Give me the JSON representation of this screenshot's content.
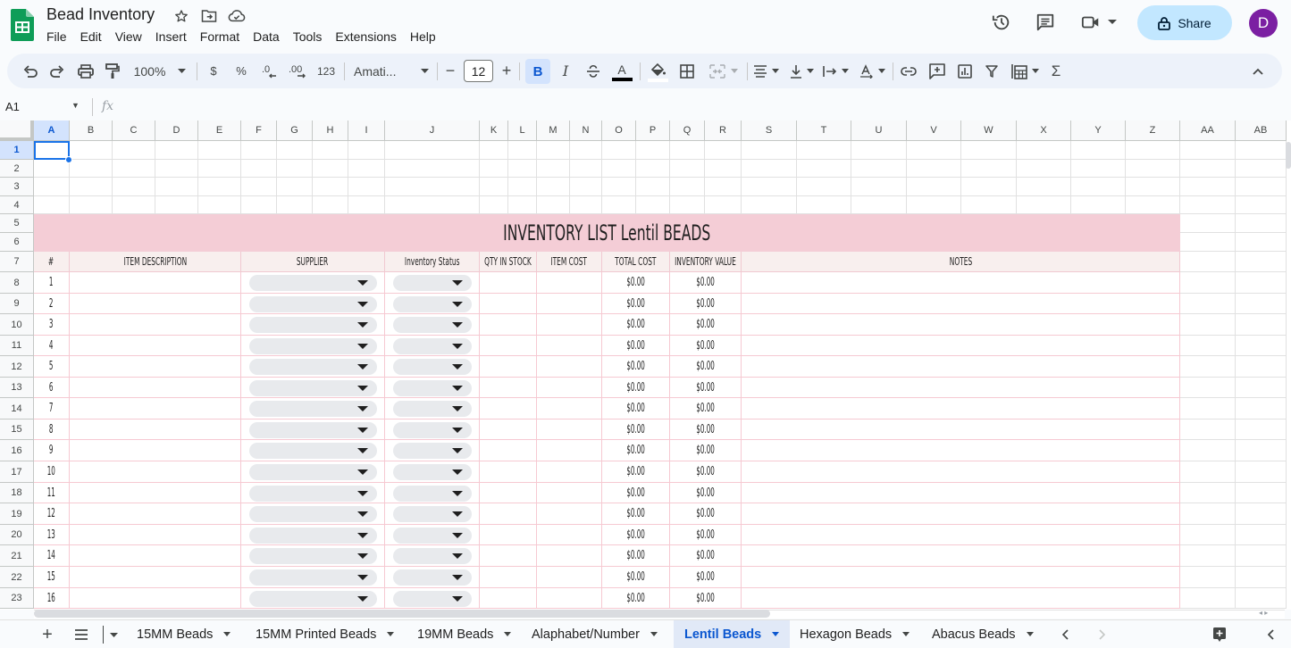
{
  "app": {
    "title": "Bead Inventory",
    "menu": [
      "File",
      "Edit",
      "View",
      "Insert",
      "Format",
      "Data",
      "Tools",
      "Extensions",
      "Help"
    ],
    "share_label": "Share",
    "avatar_initial": "D",
    "colors": {
      "accent": "#0b57d0",
      "share_bg": "#c2e7ff",
      "avatar_bg": "#7b1fa2",
      "banner_bg": "#f4cdd6",
      "header_bg": "#f8efee",
      "border_pink": "#f6c9d2"
    }
  },
  "toolbar": {
    "zoom": "100%",
    "currency": "$",
    "percent": "%",
    "decrease_decimal": ".0",
    "increase_decimal": ".00",
    "number_format": "123",
    "font": "Amati...",
    "font_size": "12",
    "bold_label": "B",
    "italic_label": "I",
    "text_color_label": "A"
  },
  "formula_bar": {
    "name_box": "A1",
    "fx_label": "fx",
    "formula": ""
  },
  "grid": {
    "columns": [
      "A",
      "B",
      "C",
      "D",
      "E",
      "F",
      "G",
      "H",
      "I",
      "J",
      "K",
      "L",
      "M",
      "N",
      "O",
      "P",
      "Q",
      "R",
      "S",
      "T",
      "U",
      "V",
      "W",
      "X",
      "Y",
      "Z",
      "AA",
      "AB"
    ],
    "rows": [
      "1",
      "2",
      "3",
      "4",
      "5",
      "6",
      "7",
      "8",
      "9",
      "10",
      "11",
      "12",
      "13",
      "14",
      "15",
      "16",
      "17",
      "18",
      "19",
      "20",
      "21",
      "22",
      "23"
    ],
    "selected_cell": "A1"
  },
  "sheet": {
    "banner_title": "INVENTORY LIST Lentil BEADS",
    "headers": {
      "number": "#",
      "item_description": "ITEM DESCRIPTION",
      "supplier": "SUPPLIER",
      "inventory_status": "Inventory Status",
      "qty_in_stock": "QTY IN STOCK",
      "item_cost": "ITEM COST",
      "total_cost": "TOTAL COST",
      "inventory_value": "INVENTORY VALUE",
      "notes": "NOTES"
    },
    "rows": [
      {
        "num": "1",
        "total_cost": "$0.00",
        "inventory_value": "$0.00"
      },
      {
        "num": "2",
        "total_cost": "$0.00",
        "inventory_value": "$0.00"
      },
      {
        "num": "3",
        "total_cost": "$0.00",
        "inventory_value": "$0.00"
      },
      {
        "num": "4",
        "total_cost": "$0.00",
        "inventory_value": "$0.00"
      },
      {
        "num": "5",
        "total_cost": "$0.00",
        "inventory_value": "$0.00"
      },
      {
        "num": "6",
        "total_cost": "$0.00",
        "inventory_value": "$0.00"
      },
      {
        "num": "7",
        "total_cost": "$0.00",
        "inventory_value": "$0.00"
      },
      {
        "num": "8",
        "total_cost": "$0.00",
        "inventory_value": "$0.00"
      },
      {
        "num": "9",
        "total_cost": "$0.00",
        "inventory_value": "$0.00"
      },
      {
        "num": "10",
        "total_cost": "$0.00",
        "inventory_value": "$0.00"
      },
      {
        "num": "11",
        "total_cost": "$0.00",
        "inventory_value": "$0.00"
      },
      {
        "num": "12",
        "total_cost": "$0.00",
        "inventory_value": "$0.00"
      },
      {
        "num": "13",
        "total_cost": "$0.00",
        "inventory_value": "$0.00"
      },
      {
        "num": "14",
        "total_cost": "$0.00",
        "inventory_value": "$0.00"
      },
      {
        "num": "15",
        "total_cost": "$0.00",
        "inventory_value": "$0.00"
      },
      {
        "num": "16",
        "total_cost": "$0.00",
        "inventory_value": "$0.00"
      }
    ]
  },
  "tabs": [
    {
      "label": "15MM Beads",
      "active": false
    },
    {
      "label": "15MM Printed Beads",
      "active": false
    },
    {
      "label": "19MM Beads",
      "active": false
    },
    {
      "label": "Alaphabet/Number",
      "active": false
    },
    {
      "label": "Lentil Beads",
      "active": true
    },
    {
      "label": "Hexagon Beads",
      "active": false
    },
    {
      "label": "Abacus Beads",
      "active": false
    }
  ]
}
